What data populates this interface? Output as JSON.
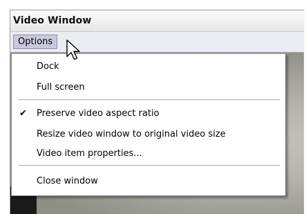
{
  "window": {
    "title": "Video Window"
  },
  "menubar": {
    "options_label": "Options"
  },
  "menu": {
    "items": [
      {
        "label": "Dock",
        "checked": false
      },
      {
        "label": "Full screen",
        "checked": false
      },
      {
        "label": "Preserve video aspect ratio",
        "checked": true
      },
      {
        "label": "Resize video window to original video size",
        "checked": false
      },
      {
        "label": "Video item properties...",
        "checked": false
      },
      {
        "label": "Close window",
        "checked": false
      }
    ],
    "check_glyph": "✔"
  },
  "icons": {
    "cursor": "arrow-pointer-icon",
    "check": "checkmark-icon"
  }
}
